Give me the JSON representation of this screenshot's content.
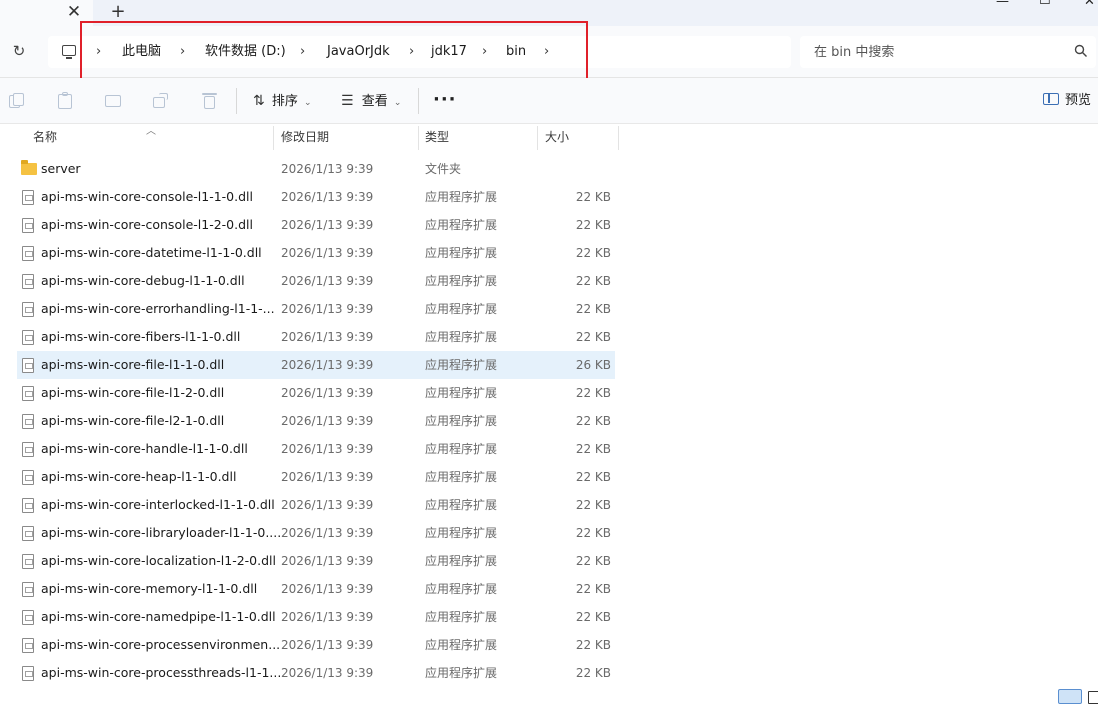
{
  "window": {
    "tab_close": "✕",
    "new_tab": "+",
    "minimize": "—",
    "maximize": "☐",
    "close": "✕"
  },
  "address": {
    "refresh_glyph": "↻",
    "breadcrumb": [
      "此电脑",
      "软件数据 (D:)",
      "JavaOrJdk",
      "jdk17",
      "bin"
    ],
    "separator": "›"
  },
  "search": {
    "placeholder": "在 bin 中搜索"
  },
  "toolbar": {
    "sort_label": "排序",
    "view_label": "查看",
    "more_label": "···",
    "preview_label": "预览"
  },
  "columns": {
    "name": "名称",
    "date": "修改日期",
    "type": "类型",
    "size": "大小"
  },
  "files": [
    {
      "name": "server",
      "date": "2026/1/13 9:39",
      "type": "文件夹",
      "size": "",
      "icon": "folder-icon"
    },
    {
      "name": "api-ms-win-core-console-l1-1-0.dll",
      "date": "2026/1/13 9:39",
      "type": "应用程序扩展",
      "size": "22 KB",
      "icon": "dll-file-icon"
    },
    {
      "name": "api-ms-win-core-console-l1-2-0.dll",
      "date": "2026/1/13 9:39",
      "type": "应用程序扩展",
      "size": "22 KB",
      "icon": "dll-file-icon"
    },
    {
      "name": "api-ms-win-core-datetime-l1-1-0.dll",
      "date": "2026/1/13 9:39",
      "type": "应用程序扩展",
      "size": "22 KB",
      "icon": "dll-file-icon"
    },
    {
      "name": "api-ms-win-core-debug-l1-1-0.dll",
      "date": "2026/1/13 9:39",
      "type": "应用程序扩展",
      "size": "22 KB",
      "icon": "dll-file-icon"
    },
    {
      "name": "api-ms-win-core-errorhandling-l1-1-...",
      "date": "2026/1/13 9:39",
      "type": "应用程序扩展",
      "size": "22 KB",
      "icon": "dll-file-icon"
    },
    {
      "name": "api-ms-win-core-fibers-l1-1-0.dll",
      "date": "2026/1/13 9:39",
      "type": "应用程序扩展",
      "size": "22 KB",
      "icon": "dll-file-icon"
    },
    {
      "name": "api-ms-win-core-file-l1-1-0.dll",
      "date": "2026/1/13 9:39",
      "type": "应用程序扩展",
      "size": "26 KB",
      "icon": "dll-file-icon",
      "selected": true
    },
    {
      "name": "api-ms-win-core-file-l1-2-0.dll",
      "date": "2026/1/13 9:39",
      "type": "应用程序扩展",
      "size": "22 KB",
      "icon": "dll-file-icon"
    },
    {
      "name": "api-ms-win-core-file-l2-1-0.dll",
      "date": "2026/1/13 9:39",
      "type": "应用程序扩展",
      "size": "22 KB",
      "icon": "dll-file-icon"
    },
    {
      "name": "api-ms-win-core-handle-l1-1-0.dll",
      "date": "2026/1/13 9:39",
      "type": "应用程序扩展",
      "size": "22 KB",
      "icon": "dll-file-icon"
    },
    {
      "name": "api-ms-win-core-heap-l1-1-0.dll",
      "date": "2026/1/13 9:39",
      "type": "应用程序扩展",
      "size": "22 KB",
      "icon": "dll-file-icon"
    },
    {
      "name": "api-ms-win-core-interlocked-l1-1-0.dll",
      "date": "2026/1/13 9:39",
      "type": "应用程序扩展",
      "size": "22 KB",
      "icon": "dll-file-icon"
    },
    {
      "name": "api-ms-win-core-libraryloader-l1-1-0....",
      "date": "2026/1/13 9:39",
      "type": "应用程序扩展",
      "size": "22 KB",
      "icon": "dll-file-icon"
    },
    {
      "name": "api-ms-win-core-localization-l1-2-0.dll",
      "date": "2026/1/13 9:39",
      "type": "应用程序扩展",
      "size": "22 KB",
      "icon": "dll-file-icon"
    },
    {
      "name": "api-ms-win-core-memory-l1-1-0.dll",
      "date": "2026/1/13 9:39",
      "type": "应用程序扩展",
      "size": "22 KB",
      "icon": "dll-file-icon"
    },
    {
      "name": "api-ms-win-core-namedpipe-l1-1-0.dll",
      "date": "2026/1/13 9:39",
      "type": "应用程序扩展",
      "size": "22 KB",
      "icon": "dll-file-icon"
    },
    {
      "name": "api-ms-win-core-processenvironmen...",
      "date": "2026/1/13 9:39",
      "type": "应用程序扩展",
      "size": "22 KB",
      "icon": "dll-file-icon"
    },
    {
      "name": "api-ms-win-core-processthreads-l1-1...",
      "date": "2026/1/13 9:39",
      "type": "应用程序扩展",
      "size": "22 KB",
      "icon": "dll-file-icon"
    }
  ],
  "colors": {
    "highlight_box": "#e0202a",
    "selected_row": "#e5f1fb",
    "folder": "#f5c242",
    "accent": "#3c6fb4"
  }
}
